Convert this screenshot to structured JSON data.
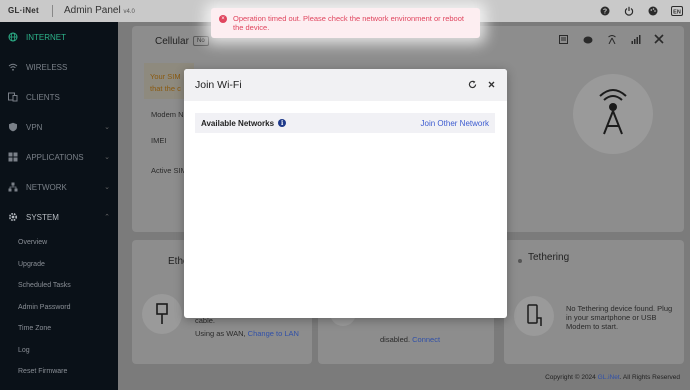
{
  "header": {
    "logo": "GL·iNet",
    "title": "Admin Panel",
    "version": "v4.0",
    "icons": [
      "help-icon",
      "power-icon",
      "theme-icon",
      "language-icon"
    ]
  },
  "sidebar": {
    "items": [
      {
        "label": "INTERNET",
        "icon": "globe-icon",
        "active": true
      },
      {
        "label": "WIRELESS",
        "icon": "wifi-icon"
      },
      {
        "label": "CLIENTS",
        "icon": "clients-icon"
      },
      {
        "label": "VPN",
        "icon": "shield-icon",
        "chevron": "⌄"
      },
      {
        "label": "APPLICATIONS",
        "icon": "grid-icon",
        "chevron": "⌄"
      },
      {
        "label": "NETWORK",
        "icon": "network-icon",
        "chevron": "⌄"
      },
      {
        "label": "SYSTEM",
        "icon": "gear-icon",
        "chevron": "⌃"
      }
    ],
    "sub_items": [
      "Overview",
      "Upgrade",
      "Scheduled Tasks",
      "Admin Password",
      "Time Zone",
      "Log",
      "Reset Firmware"
    ]
  },
  "cellular": {
    "title": "Cellular",
    "badge": "No",
    "warning_line1": "Your SIM",
    "warning_line2": "that the c",
    "modem_label": "Modem N",
    "imei_label": "IMEI",
    "active_sim_label": "Active SIM"
  },
  "ethernet": {
    "title": "Ethe",
    "text_partial": "cable.",
    "wan_text": "Using as WAN,",
    "wan_link": "Change to LAN"
  },
  "repeater": {
    "text": "disabled.",
    "link": "Connect"
  },
  "tethering": {
    "title": "Tethering",
    "text": "No Tethering device found. Plug in your smartphone or USB Modem to start."
  },
  "modal": {
    "title": "Join Wi-Fi",
    "row_label": "Available Networks",
    "info": "i",
    "row_link": "Join Other Network"
  },
  "toast": {
    "icon": "×",
    "message": "Operation timed out. Please check the network environment or reboot the device."
  },
  "footer": {
    "prefix": "Copyright © 2024",
    "brand": "GL.iNet",
    "suffix": ". All Rights Reserved"
  },
  "colors": {
    "accent": "#2db38a",
    "sidebar_bg": "#0a1118",
    "error": "#e0455e",
    "link": "#3c5bd0"
  }
}
